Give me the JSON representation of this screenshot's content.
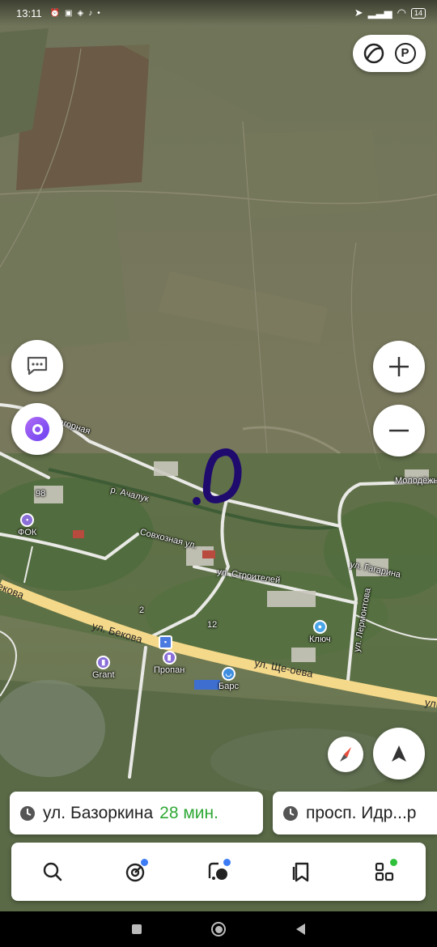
{
  "status_bar": {
    "time": "13:11",
    "battery": "14"
  },
  "map": {
    "annotation_color": "#1f0a6e",
    "route_highlight_color": "#f5d98a",
    "labels": [
      {
        "id": "r-achaluk",
        "text": "р. Ачалук"
      },
      {
        "id": "sovkhoznaya",
        "text": "Совхозная ул."
      },
      {
        "id": "stroiteley",
        "text": "ул. Строителей"
      },
      {
        "id": "gagarina",
        "text": "ул. Гагарина"
      },
      {
        "id": "molodezhnaya",
        "text": "Молодёжная"
      },
      {
        "id": "nagornaya",
        "text": "Нагорная"
      },
      {
        "id": "lermontova",
        "text": "ул. Лермонтова"
      },
      {
        "id": "house-98",
        "text": "98"
      },
      {
        "id": "house-2",
        "text": "2"
      },
      {
        "id": "house-12",
        "text": "12"
      }
    ],
    "roads": {
      "bekova_left": "екова",
      "bekova": "ул. Бекова",
      "shcheeva": "ул. Ще-оева",
      "edge": "ул"
    },
    "pois": {
      "fok": "ФОК",
      "grant": "Grant",
      "propan": "Пропан",
      "bars": "Барс",
      "klyuch": "Ключ"
    }
  },
  "controls": {
    "layers_icon": "layers-icon",
    "parking_icon": "parking-icon",
    "parking_glyph": "P",
    "chat_icon": "chat-bubble-icon",
    "alice_icon": "alice-voice-assistant-icon",
    "zoom_in_icon": "plus-icon",
    "zoom_out_icon": "minus-icon",
    "compass_icon": "compass-icon",
    "locate_icon": "navigation-arrow-icon"
  },
  "routes": [
    {
      "destination": "ул. Базоркина",
      "duration": "28 мин."
    },
    {
      "destination": "просп. Идр...р",
      "duration": ""
    }
  ],
  "tabs": [
    {
      "id": "search",
      "icon": "search-icon"
    },
    {
      "id": "navigator",
      "icon": "navigator-icon",
      "badge_color": "#3d7cf5"
    },
    {
      "id": "transport",
      "icon": "transport-icon",
      "badge_color": "#3d7cf5"
    },
    {
      "id": "bookmarks",
      "icon": "bookmark-icon"
    },
    {
      "id": "services",
      "icon": "services-grid-icon",
      "badge_color": "#2fc13a"
    }
  ],
  "system_nav": [
    "recents-button",
    "home-button",
    "back-button"
  ]
}
